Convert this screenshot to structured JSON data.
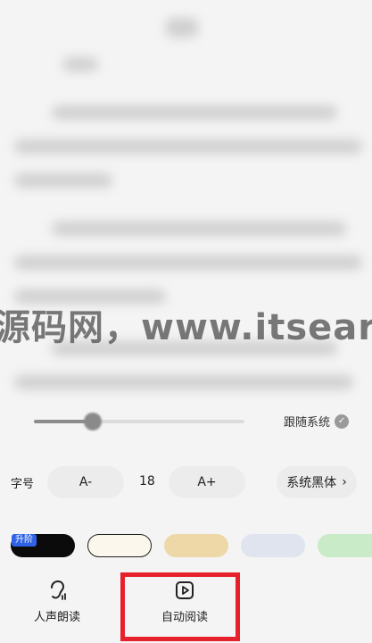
{
  "reader": {
    "blurred": true
  },
  "watermark": {
    "text": "源码网，www.itsear.c"
  },
  "brightness": {
    "level": 0.28,
    "follow_label": "跟随系统",
    "follow_checked": true
  },
  "font": {
    "label": "字号",
    "decrease_label": "A-",
    "size_value": "18",
    "increase_label": "A+",
    "family_label": "系统黑体"
  },
  "themes": {
    "badge": "升阶",
    "swatches": [
      {
        "name": "black",
        "color": "#0b0b0b",
        "selected": false
      },
      {
        "name": "cream",
        "color": "#fbf7ec",
        "selected": true
      },
      {
        "name": "tan",
        "color": "#efd8a8",
        "selected": false
      },
      {
        "name": "blue-gray",
        "color": "#dfe4ee",
        "selected": false
      },
      {
        "name": "green",
        "color": "#c9ebc7",
        "selected": false
      }
    ]
  },
  "bottom_nav": {
    "items": [
      {
        "label": "人声朗读",
        "icon": "ear-icon"
      },
      {
        "label": "自动阅读",
        "icon": "auto-read-icon"
      }
    ]
  },
  "colors": {
    "highlight": "#e7212c",
    "badge": "#2f62e6"
  }
}
